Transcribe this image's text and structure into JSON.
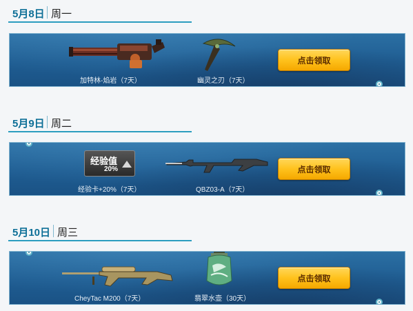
{
  "days": [
    {
      "date": "5月8日",
      "weekday": "周一",
      "items": [
        {
          "caption": "加特林-焰岩（7天）",
          "icon": "gatling-gun-icon"
        },
        {
          "caption": "幽灵之刃（7天）",
          "icon": "scythe-blade-icon"
        }
      ],
      "button_label": "点击领取"
    },
    {
      "date": "5月9日",
      "weekday": "周二",
      "items": [
        {
          "caption": "经验卡+20%（7天）",
          "icon": "exp-card-icon",
          "badge_title": "经验值",
          "badge_value": "20%"
        },
        {
          "caption": "QBZ03-A（7天）",
          "icon": "assault-rifle-icon"
        }
      ],
      "button_label": "点击领取"
    },
    {
      "date": "5月10日",
      "weekday": "周三",
      "items": [
        {
          "caption": "CheyTac M200（7天）",
          "icon": "sniper-rifle-icon"
        },
        {
          "caption": "翡翠水壶（30天）",
          "icon": "jade-canteen-icon"
        }
      ],
      "button_label": "点击领取"
    }
  ],
  "colors": {
    "accent": "#0d6f97",
    "card_bg": "#235f95",
    "button": "#ffc21d"
  }
}
